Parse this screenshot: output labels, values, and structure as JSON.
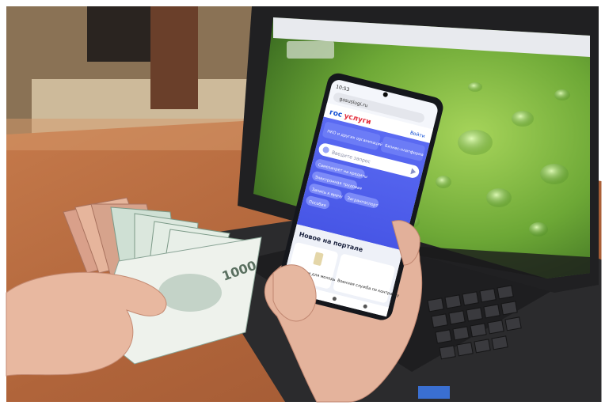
{
  "phone": {
    "status_time": "10:53",
    "url": "gosuslugi.ru",
    "logo_prefix": "гос",
    "logo_suffix": "услуги",
    "login": "Войти",
    "promo_1": "НКО и других организаций",
    "promo_2": "Бизнес-платформа",
    "search_placeholder": "Введите запрос",
    "chips": [
      "Самозапрет на кредиты",
      "Электронная трудовая",
      "Запись к врачу",
      "Загранпаспорт",
      "Пособия"
    ],
    "section_title": "Новое на портале",
    "card_1": "Вакансии для молодых",
    "card_2": "Военная служба по контракту"
  },
  "colors": {
    "accent_blue": "#4a5cf0",
    "screen_green": "#6fa83a",
    "table_wood": "#b8693e"
  }
}
